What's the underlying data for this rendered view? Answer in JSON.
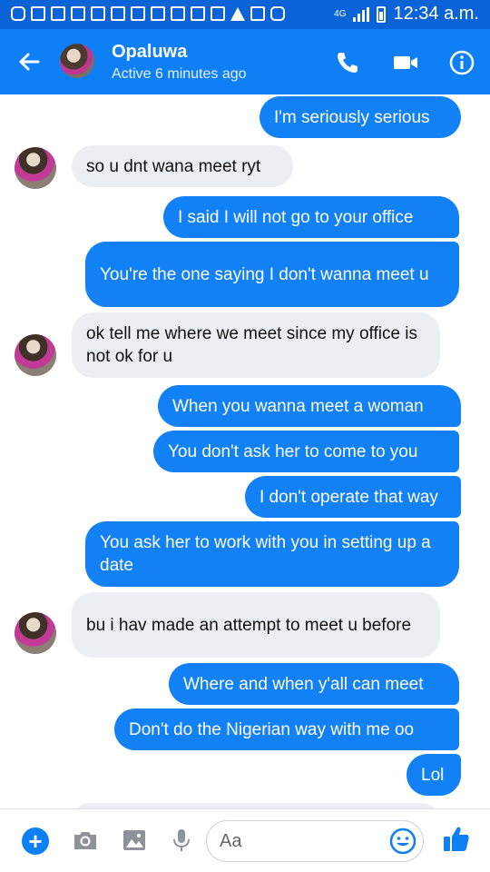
{
  "status_bar": {
    "network": "4G",
    "time": "12:34 a.m."
  },
  "header": {
    "contact_name": "Opaluwa",
    "status": "Active 6 minutes ago"
  },
  "messages": [
    {
      "sender": "me",
      "text": "I'm seriously serious"
    },
    {
      "sender": "contact",
      "text": "so u dnt wana meet ryt"
    },
    {
      "sender": "me",
      "text": "I said I will not go to your office"
    },
    {
      "sender": "me",
      "text": "You're the one saying I don't wanna meet u"
    },
    {
      "sender": "contact",
      "text": "ok tell me where we meet since my office is not ok for u"
    },
    {
      "sender": "me",
      "text": "When you wanna meet a woman"
    },
    {
      "sender": "me",
      "text": "You don't ask her to come to you"
    },
    {
      "sender": "me",
      "text": "I don't operate that way"
    },
    {
      "sender": "me",
      "text": "You ask her to work with you in setting up a date"
    },
    {
      "sender": "contact",
      "text": "bu i hav made an attempt to meet u before"
    },
    {
      "sender": "me",
      "text": "Where and when y'all can meet"
    },
    {
      "sender": "me",
      "text": "Don't do the Nigerian way with me oo"
    },
    {
      "sender": "me",
      "text": "Lol"
    }
  ],
  "composer": {
    "placeholder": "Aa"
  },
  "colors": {
    "header": "#0e7ff5",
    "status_bar": "#0a64d8",
    "outgoing_bubble": "#1281f6",
    "incoming_bubble": "#eceff1"
  }
}
